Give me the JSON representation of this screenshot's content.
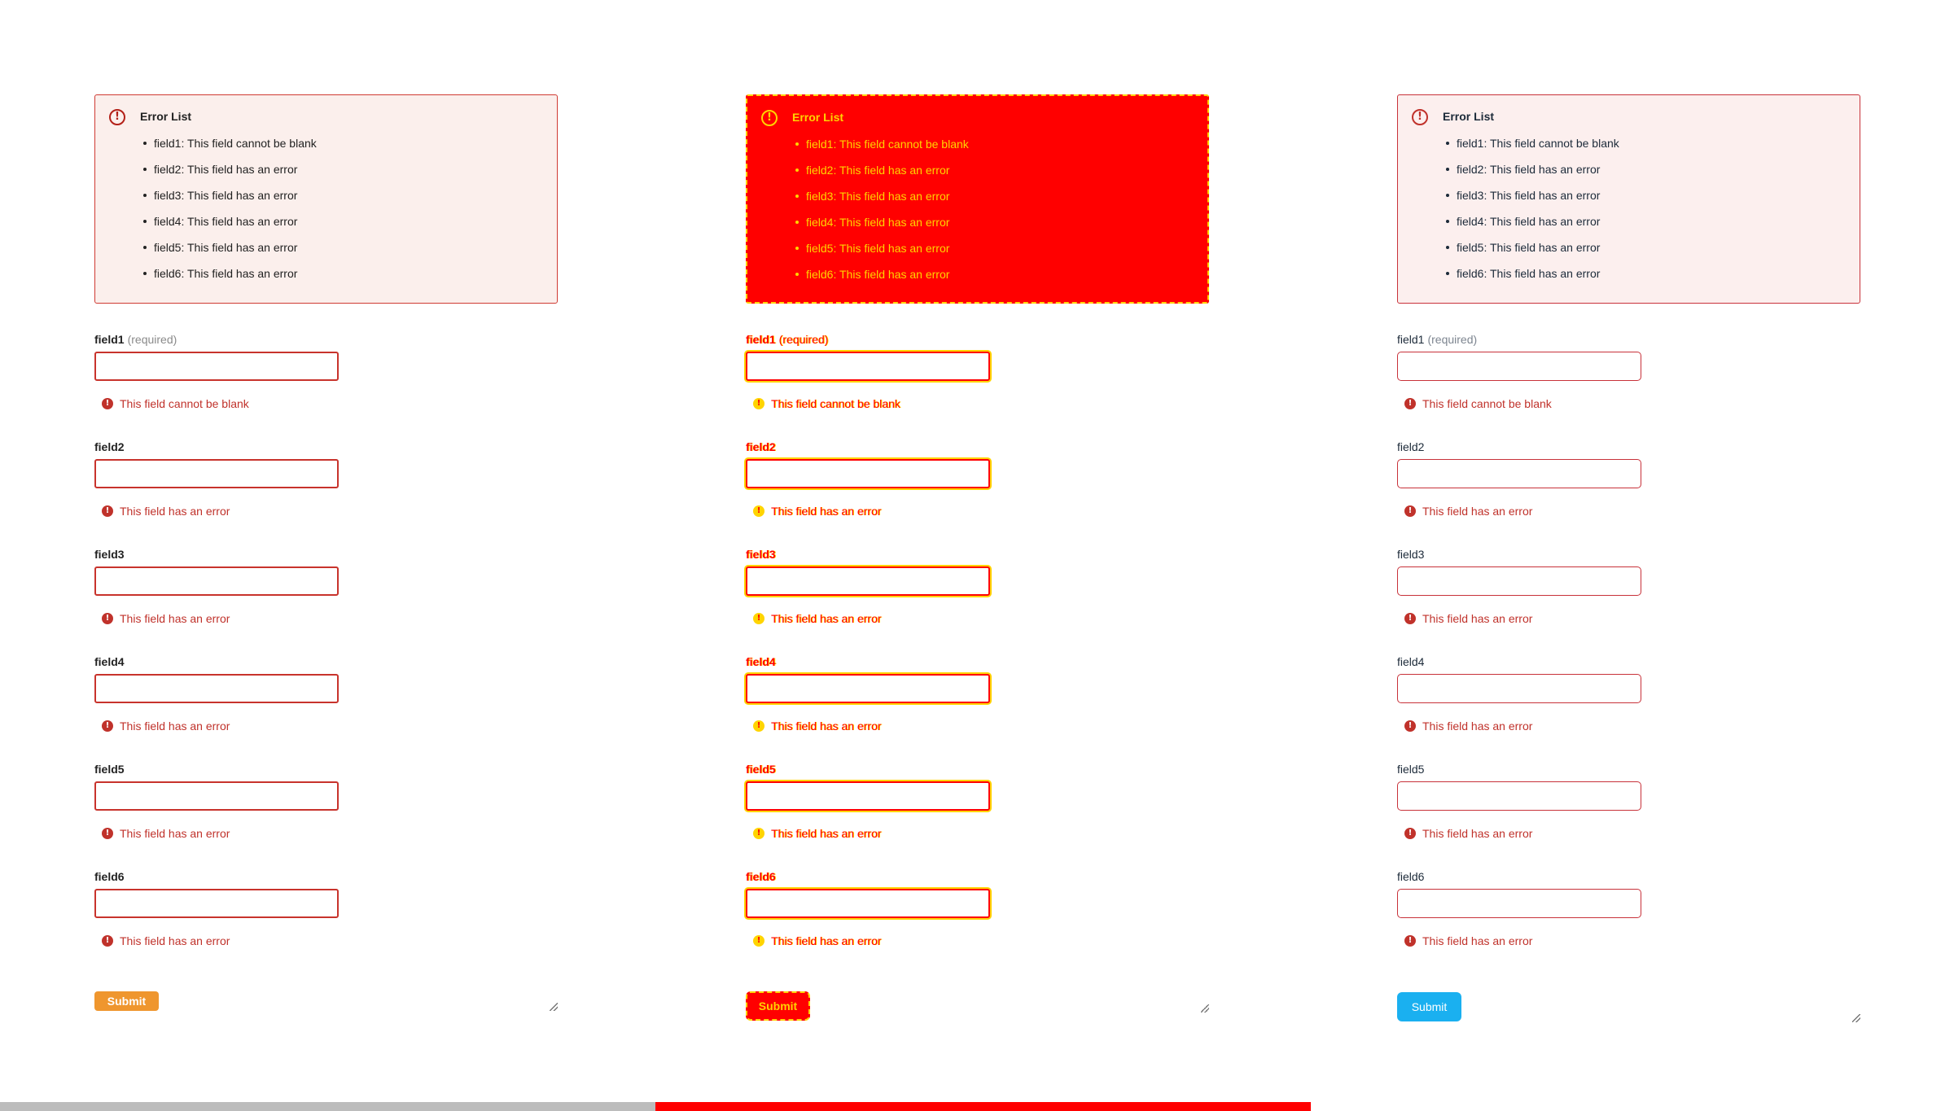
{
  "error_list": {
    "title": "Error List",
    "alert_icon": "!",
    "items": [
      "field1: This field cannot be blank",
      "field2: This field has an error",
      "field3: This field has an error",
      "field4: This field has an error",
      "field5: This field has an error",
      "field6: This field has an error"
    ]
  },
  "fields": [
    {
      "label": "field1",
      "required": "(required)",
      "error": "This field cannot be blank"
    },
    {
      "label": "field2",
      "required": "",
      "error": "This field has an error"
    },
    {
      "label": "field3",
      "required": "",
      "error": "This field has an error"
    },
    {
      "label": "field4",
      "required": "",
      "error": "This field has an error"
    },
    {
      "label": "field5",
      "required": "",
      "error": "This field has an error"
    },
    {
      "label": "field6",
      "required": "",
      "error": "This field has an error"
    }
  ],
  "error_icon": "!",
  "submit_label": "Submit",
  "colors": {
    "error_red": "#c0322b",
    "submit_orange": "#ef962e",
    "submit_blue": "#1ab0f0",
    "diff_red": "#ff0000",
    "diff_yellow": "#ffd400"
  }
}
